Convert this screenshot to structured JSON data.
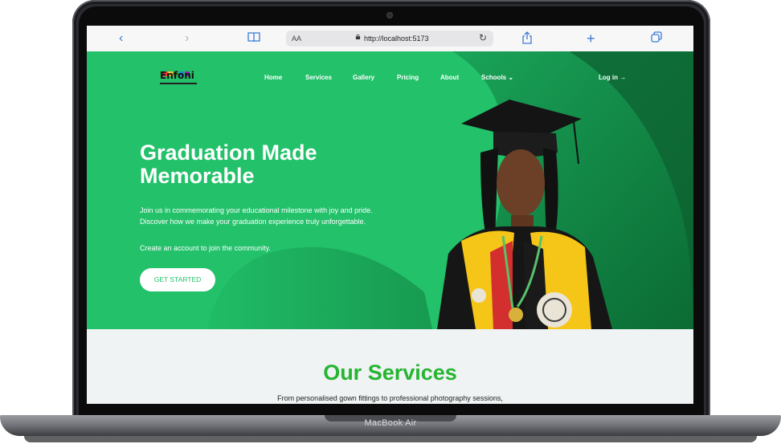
{
  "device": {
    "label": "MacBook Air"
  },
  "browser": {
    "url_prefix": "AA",
    "url": "http://localhost:5173"
  },
  "site": {
    "logo_text": "Enfoni",
    "logo_colors": [
      "#e53935",
      "#fbc02d",
      "#43a047",
      "#1e88e5",
      "#8e24aa"
    ],
    "nav": {
      "home": "Home",
      "services": "Services",
      "gallery": "Gallery",
      "pricing": "Pricing",
      "about": "About",
      "schools": "Schools",
      "login": "Log in →"
    },
    "hero": {
      "title_line1": "Graduation Made",
      "title_line2": "Memorable",
      "sub_line1": "Join us in commemorating your educational milestone with joy and pride.",
      "sub_line2": "Discover how we make your graduation experience truly unforgettable.",
      "cta_text": "Create an account to join the community.",
      "button": "GET STARTED"
    },
    "services": {
      "title": "Our Services",
      "subtitle": "From personalised gown fittings to professional photography sessions,"
    }
  },
  "colors": {
    "brand_green": "#22c16a",
    "dark_green": "#0b6b33",
    "services_title": "#26b531"
  }
}
